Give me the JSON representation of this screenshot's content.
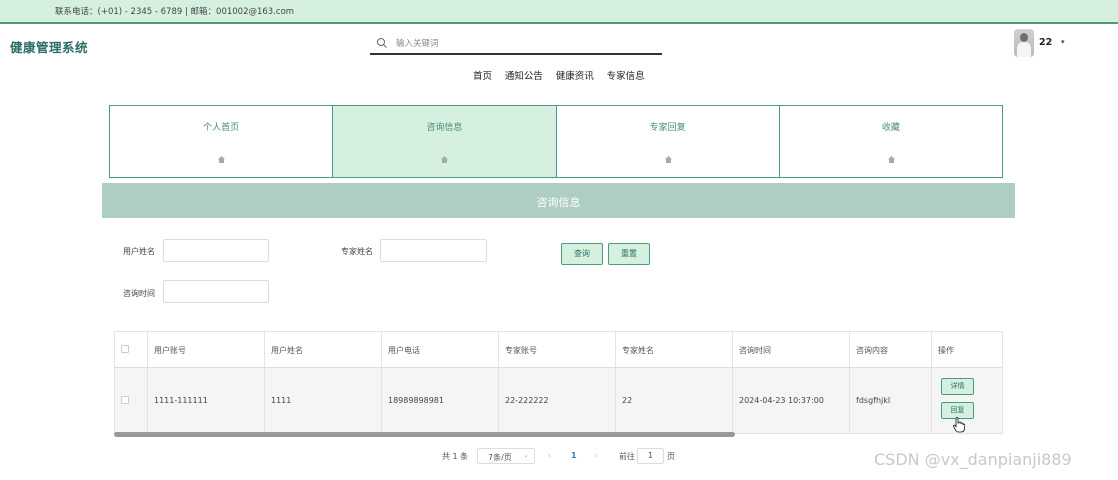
{
  "topbar": {
    "contact": "联系电话：(+01) - 2345 - 6789 | 邮箱：001002@163.com"
  },
  "header": {
    "logo": "健康管理系统",
    "search_placeholder": "输入关键词",
    "user_name": "22",
    "caret": "▾"
  },
  "nav": {
    "items": [
      "首页",
      "通知公告",
      "健康资讯",
      "专家信息"
    ]
  },
  "tabs": [
    {
      "label": "个人首页",
      "active": false
    },
    {
      "label": "咨询信息",
      "active": true
    },
    {
      "label": "专家回复",
      "active": false
    },
    {
      "label": "收藏",
      "active": false
    }
  ],
  "banner": {
    "title": "咨询信息"
  },
  "filters": {
    "user_name_label": "用户姓名",
    "expert_name_label": "专家姓名",
    "consult_time_label": "咨询时间",
    "query_button": "查询",
    "reset_button": "重置"
  },
  "table": {
    "headers": [
      "用户账号",
      "用户姓名",
      "用户电话",
      "专家账号",
      "专家姓名",
      "咨询时间",
      "咨询内容",
      "操作"
    ],
    "rows": [
      {
        "user_account": "1111-111111",
        "user_name": "1111",
        "user_phone": "18989898981",
        "expert_account": "22-222222",
        "expert_name": "22",
        "consult_time": "2024-04-23 10:37:00",
        "content": "fdsgfhjkl",
        "actions": [
          "详情",
          "回复"
        ]
      }
    ]
  },
  "pagination": {
    "total": "共 1 条",
    "page_size": "7条/页",
    "prev": "‹",
    "current": "1",
    "next": "›",
    "goto_label": "前往",
    "goto_value": "1",
    "page_unit": "页"
  },
  "watermark": "CSDN @vx_danpianji889",
  "colors": {
    "accent": "#4a9a86",
    "tab_active_bg": "#d6f0e0",
    "banner_bg": "#aecec4",
    "topbar_bg": "#d6f0e0"
  },
  "icons": [
    "search-icon",
    "user-avatar",
    "home-icon",
    "checkbox",
    "cursor-hand-icon"
  ]
}
